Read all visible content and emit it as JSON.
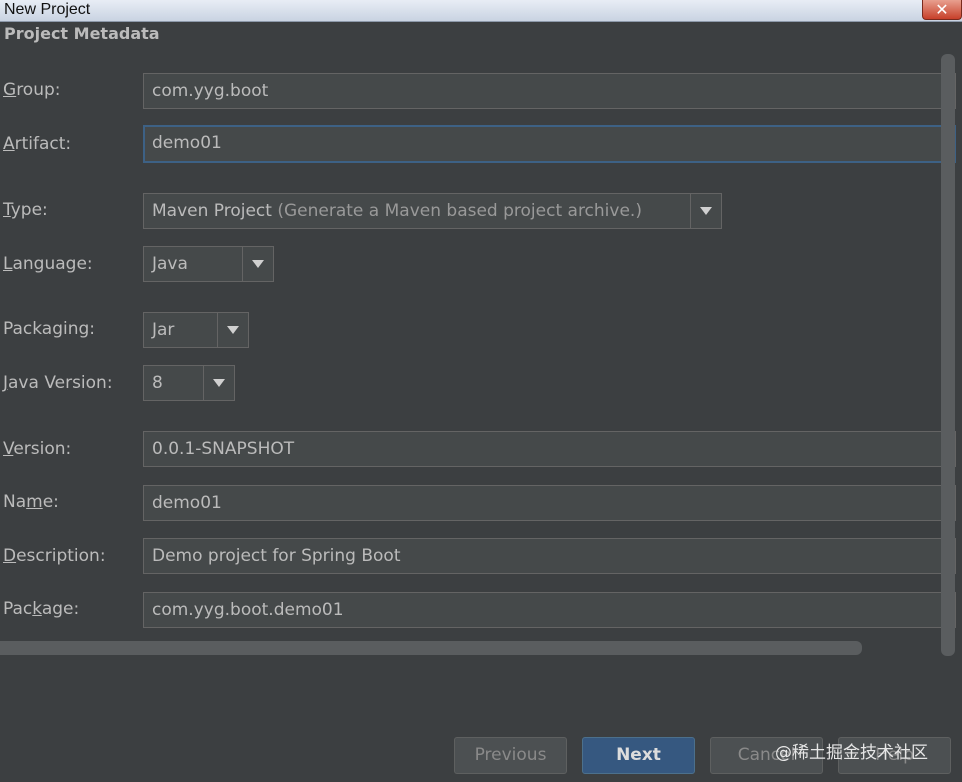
{
  "window": {
    "title": "New Project",
    "close_label": "✕"
  },
  "section": {
    "title": "Project Metadata"
  },
  "form": {
    "group": {
      "label_mnemonic": "G",
      "label_rest": "roup:",
      "value": "com.yyg.boot"
    },
    "artifact": {
      "label_mnemonic": "A",
      "label_rest": "rtifact:",
      "value": "demo01"
    },
    "type": {
      "label_mnemonic": "T",
      "label_rest": "ype:",
      "value": "Maven Project",
      "hint": "(Generate a Maven based project archive.)"
    },
    "language": {
      "label_mnemonic": "L",
      "label_rest": "anguage:",
      "value": "Java"
    },
    "packaging": {
      "label": "Packaging:",
      "value": "Jar"
    },
    "java_version": {
      "label_mnemonic": "J",
      "label_rest": "ava Version:",
      "value": "8"
    },
    "version": {
      "label_mnemonic": "V",
      "label_rest": "ersion:",
      "value": "0.0.1-SNAPSHOT"
    },
    "name": {
      "label_before": "Na",
      "label_mnemonic": "m",
      "label_after": "e:",
      "value": "demo01"
    },
    "description": {
      "label_mnemonic": "D",
      "label_rest": "escription:",
      "value": "Demo project for Spring Boot"
    },
    "package": {
      "label_before": "Pac",
      "label_mnemonic": "k",
      "label_after": "age:",
      "value": "com.yyg.boot.demo01"
    }
  },
  "buttons": {
    "previous": "Previous",
    "next": "Next",
    "cancel": "Cancel",
    "help": "Help"
  },
  "watermark": "@稀土掘金技术社区",
  "icons": {
    "dropdown": "chevron-down-icon",
    "close": "close-icon"
  }
}
